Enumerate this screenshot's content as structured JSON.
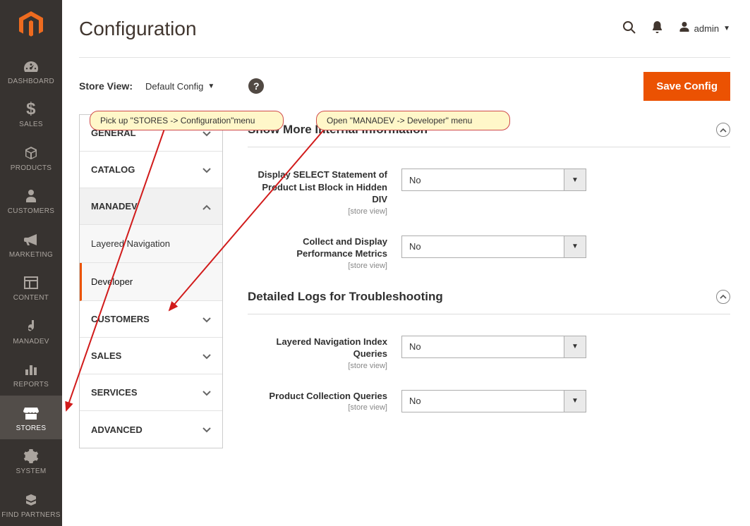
{
  "sidebar": {
    "items": [
      {
        "label": "DASHBOARD"
      },
      {
        "label": "SALES"
      },
      {
        "label": "PRODUCTS"
      },
      {
        "label": "CUSTOMERS"
      },
      {
        "label": "MARKETING"
      },
      {
        "label": "CONTENT"
      },
      {
        "label": "MANADEV"
      },
      {
        "label": "REPORTS"
      },
      {
        "label": "STORES"
      },
      {
        "label": "SYSTEM"
      },
      {
        "label": "FIND PARTNERS"
      }
    ]
  },
  "header": {
    "title": "Configuration",
    "user_label": "admin"
  },
  "storeview": {
    "label": "Store View:",
    "selected": "Default Config",
    "help": "?",
    "save_label": "Save Config"
  },
  "callouts": {
    "left": "Pick up \"STORES -> Configuration\"menu",
    "right": "Open \"MANADEV -> Developer\" menu"
  },
  "tabs": {
    "general": "GENERAL",
    "catalog": "CATALOG",
    "manadev": "MANADEV",
    "customers": "CUSTOMERS",
    "sales": "SALES",
    "services": "SERVICES",
    "advanced": "ADVANCED",
    "sub_layered": "Layered Navigation",
    "sub_developer": "Developer"
  },
  "sections": {
    "show_more": {
      "title": "Show More Internal Information",
      "fields": {
        "select_stmt": {
          "label": "Display SELECT Statement of Product List Block in Hidden DIV",
          "scope": "[store view]",
          "value": "No"
        },
        "perf_metrics": {
          "label": "Collect and Display Performance Metrics",
          "scope": "[store view]",
          "value": "No"
        }
      }
    },
    "detailed_logs": {
      "title": "Detailed Logs for Troubleshooting",
      "fields": {
        "ln_index_queries": {
          "label": "Layered Navigation Index Queries",
          "scope": "[store view]",
          "value": "No"
        },
        "product_collection": {
          "label": "Product Collection Queries",
          "scope": "[store view]",
          "value": "No"
        }
      }
    }
  }
}
